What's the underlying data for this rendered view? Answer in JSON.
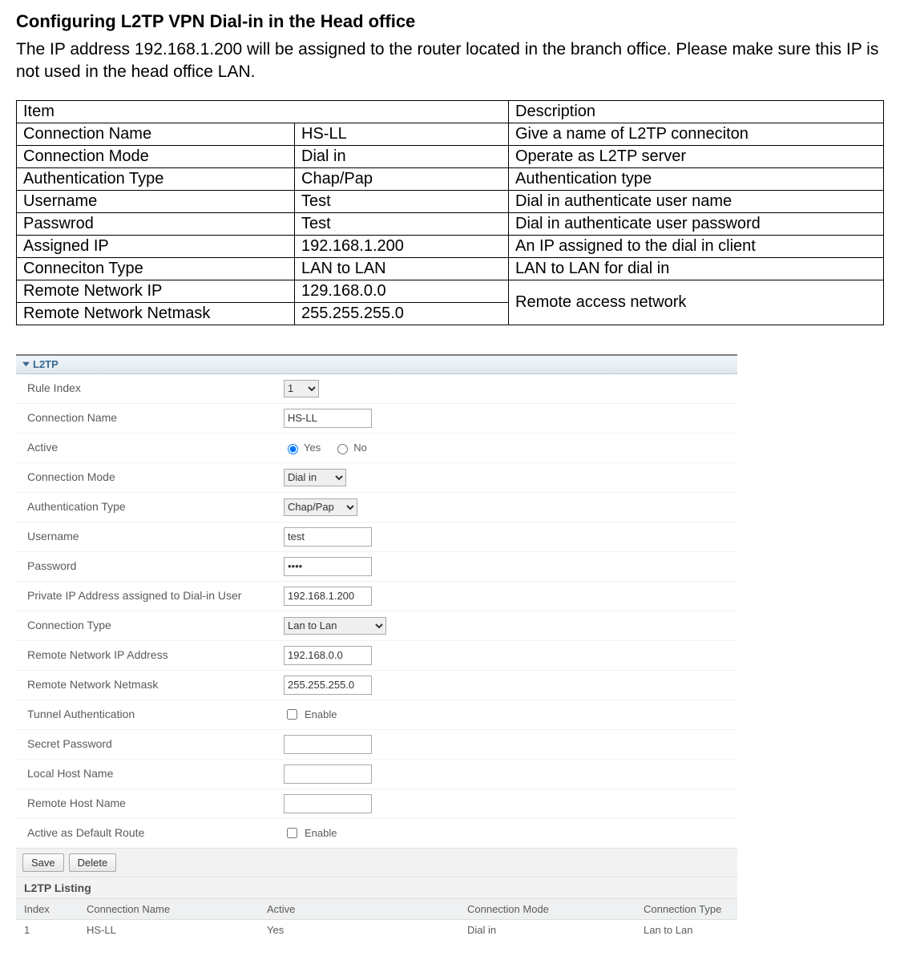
{
  "heading": "Configuring L2TP VPN Dial-in in the Head office",
  "intro": "The IP address 192.168.1.200 will be assigned to the router located in the branch office. Please make sure this IP is not used in the head office LAN.",
  "table": {
    "header_item": "Item",
    "header_desc": "Description",
    "rows": [
      {
        "item": "Connection Name",
        "val": "HS-LL",
        "desc": "Give a name of L2TP conneciton"
      },
      {
        "item": "Connection Mode",
        "val": "Dial in",
        "desc": "Operate as L2TP server"
      },
      {
        "item": "Authentication Type",
        "val": "Chap/Pap",
        "desc": "Authentication type"
      },
      {
        "item": "Username",
        "val": "Test",
        "desc": "Dial in authenticate user name"
      },
      {
        "item": "Passwrod",
        "val": "Test",
        "desc": "Dial in authenticate user password"
      },
      {
        "item": "Assigned IP",
        "val": "192.168.1.200",
        "desc": "An IP assigned to the dial in client"
      },
      {
        "item": "Conneciton Type",
        "val": "LAN to LAN",
        "desc": "LAN to LAN for dial in"
      },
      {
        "item": "Remote Network IP",
        "val": "129.168.0.0",
        "desc": "Remote access network",
        "rowspan": 2
      },
      {
        "item": "Remote Network Netmask",
        "val": "255.255.255.0"
      }
    ]
  },
  "panel": {
    "tab": "L2TP",
    "labels": {
      "rule_index": "Rule Index",
      "conn_name": "Connection Name",
      "active": "Active",
      "conn_mode": "Connection Mode",
      "auth_type": "Authentication Type",
      "username": "Username",
      "password": "Password",
      "priv_ip": "Private IP Address assigned to Dial-in User",
      "conn_type": "Connection Type",
      "remote_ip": "Remote Network IP Address",
      "remote_mask": "Remote Network Netmask",
      "tunnel_auth": "Tunnel Authentication",
      "secret": "Secret Password",
      "local_host": "Local Host Name",
      "remote_host": "Remote Host Name",
      "default_route": "Active as Default Route",
      "yes": "Yes",
      "no": "No",
      "enable": "Enable"
    },
    "values": {
      "rule_index": "1",
      "conn_name": "HS-LL",
      "conn_mode": "Dial in",
      "auth_type": "Chap/Pap",
      "username": "test",
      "password": "••••",
      "priv_ip": "192.168.1.200",
      "conn_type": "Lan to Lan",
      "remote_ip": "192.168.0.0",
      "remote_mask": "255.255.255.0",
      "secret": "",
      "local_host": "",
      "remote_host": ""
    },
    "buttons": {
      "save": "Save",
      "delete": "Delete"
    },
    "listing_title": "L2TP Listing",
    "list_headers": {
      "idx": "Index",
      "name": "Connection Name",
      "active": "Active",
      "mode": "Connection Mode",
      "type": "Connection Type"
    },
    "list_row": {
      "idx": "1",
      "name": "HS-LL",
      "active": "Yes",
      "mode": "Dial in",
      "type": "Lan to Lan"
    }
  }
}
